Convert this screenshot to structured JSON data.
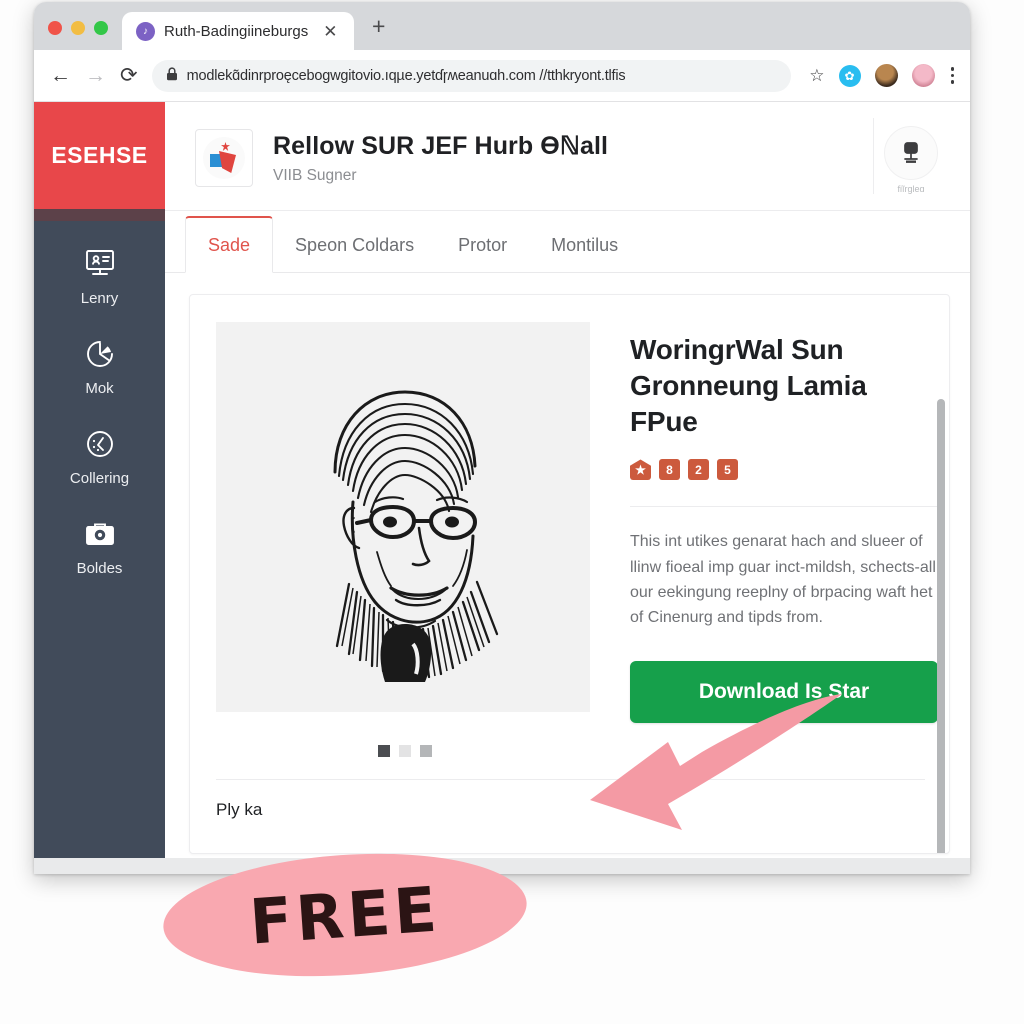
{
  "browser": {
    "tab": {
      "title": "Ruth-Badingiineburgs",
      "favicon_glyph": "♪",
      "close_glyph": "✕"
    },
    "new_tab_glyph": "+",
    "nav": {
      "back": "←",
      "forward": "→",
      "reload": "⟳"
    },
    "url": {
      "lock_glyph": "⌂",
      "text": "modlekɑ̃dinrproęcebogwgitovio.ıqµe.yetɗɼʍeanuɑh.com //tthkryont.tlfis"
    },
    "toolbar": {
      "bookmark_glyph": "☆",
      "extension_glyph": "✿",
      "menu_glyph": "⋮"
    }
  },
  "sidebar": {
    "brand": "ESEHSE",
    "items": [
      {
        "label": "Lenry",
        "icon": "monitor-icon"
      },
      {
        "label": "Mok",
        "icon": "pie-chart-icon"
      },
      {
        "label": "Collering",
        "icon": "clock-face-icon"
      },
      {
        "label": "Boldes",
        "icon": "briefcase-camera-icon"
      }
    ]
  },
  "profile": {
    "title": "Rellow SUR JEF Hurb ϴℕall",
    "subtitle": "VIIB Sugner",
    "action": {
      "label": "fiĩrgleɑ",
      "icon": "upload-badge-icon"
    }
  },
  "tabs": [
    {
      "label": "Sade",
      "active": true
    },
    {
      "label": "Speon Coldars",
      "active": false
    },
    {
      "label": "Protor",
      "active": false
    },
    {
      "label": "Montilus",
      "active": false
    }
  ],
  "product": {
    "artwork_alt": "portrait-line-art",
    "title": "WoringrWal Sun Gronneung Lamia FPue",
    "badges": [
      "★",
      "8",
      "2",
      "5"
    ],
    "description": "This int utikes genarat hach and slueer of llinw fioeal imp guar inct-mildsh, schects-all our eekingung reeplny of brpacing waft het of Cinenurg and tipds from.",
    "download_label": "Download Is Star",
    "carousel_dots": 3,
    "footer_text": "Ply ka"
  },
  "annotation": {
    "free_label": "FREE",
    "ellipse_color": "#f9a8b0",
    "arrow_color": "#f49aa4"
  },
  "colors": {
    "brand_red": "#e8474a",
    "sidebar_dark": "#414b5a",
    "tab_accent": "#e0544c",
    "download_green": "#16a04b",
    "badge_orange": "#cc5a3d"
  }
}
